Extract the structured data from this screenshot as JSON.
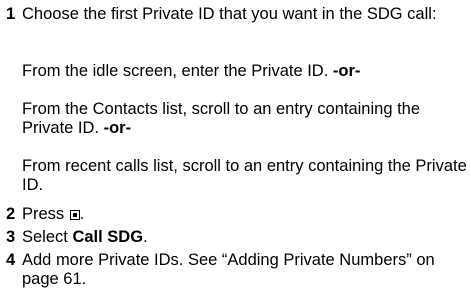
{
  "steps": [
    {
      "number": "1",
      "text": "Choose the first Private ID that you want in the SDG call:"
    },
    {
      "number": "2",
      "text_before": "Press ",
      "text_after": "."
    },
    {
      "number": "3",
      "text_before": "Select ",
      "bold": "Call SDG",
      "text_after": "."
    },
    {
      "number": "4",
      "text": "Add more Private IDs. See “Adding Private Numbers” on page 61."
    }
  ],
  "options": [
    {
      "text": "From the idle screen, enter the Private ID. ",
      "or": "-or-"
    },
    {
      "text": "From the Contacts list, scroll to an entry containing the Private ID. ",
      "or": "-or-"
    },
    {
      "text": "From recent calls list, scroll to an entry containing the Private ID."
    }
  ],
  "icons": {
    "menu_key": "menu-key-icon"
  }
}
